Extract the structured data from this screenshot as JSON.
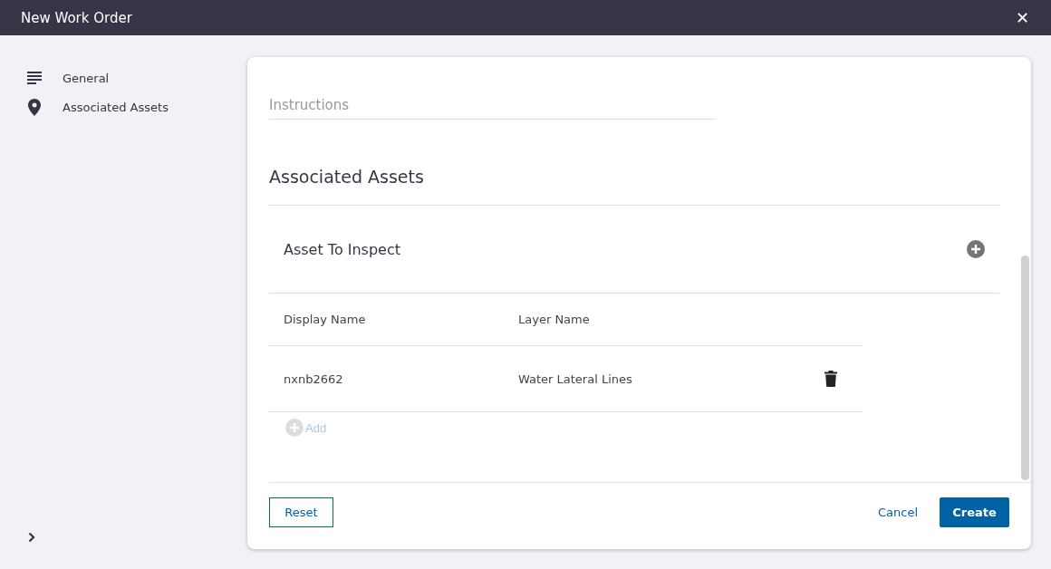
{
  "window": {
    "title": "New Work Order",
    "close_icon": "✕"
  },
  "sidebar": {
    "items": [
      {
        "kind": "list",
        "label": "General"
      },
      {
        "kind": "pin",
        "label": "Associated Assets"
      }
    ]
  },
  "form": {
    "instructions": {
      "placeholder": "Instructions"
    },
    "section_title": "Associated Assets",
    "asset_group": {
      "title": "Asset To Inspect",
      "table": {
        "columns": [
          "Display Name",
          "Layer Name"
        ],
        "rows": [
          {
            "display_name": "nxnb2662",
            "layer_name": "Water Lateral Lines"
          }
        ]
      },
      "add": {
        "label": "Add",
        "disabled": true
      }
    }
  },
  "footer": {
    "reset": "Reset",
    "cancel": "Cancel",
    "create": "Create"
  }
}
